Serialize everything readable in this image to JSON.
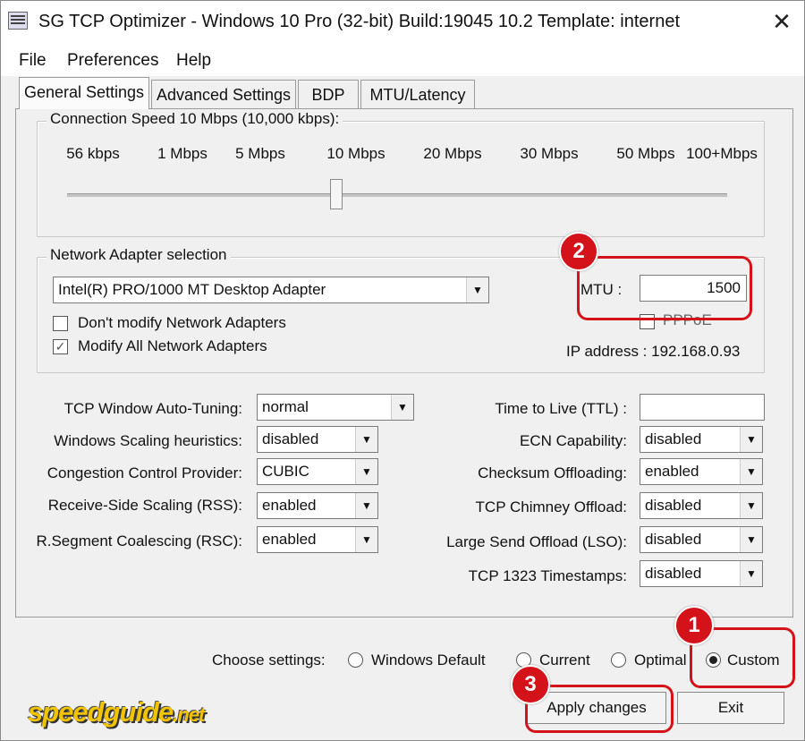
{
  "window": {
    "title": "SG TCP Optimizer - Windows 10 Pro (32-bit) Build:19045 10.2  Template: internet",
    "close_glyph": "✕"
  },
  "menu": [
    "File",
    "Preferences",
    "Help"
  ],
  "tabs": [
    "General Settings",
    "Advanced Settings",
    "BDP",
    "MTU/Latency"
  ],
  "connection_speed": {
    "legend": "Connection Speed  10 Mbps (10,000 kbps):",
    "ticks": [
      "56 kbps",
      "1 Mbps",
      "5 Mbps",
      "10 Mbps",
      "20 Mbps",
      "30 Mbps",
      "50 Mbps",
      "100+Mbps"
    ],
    "selected": "10 Mbps"
  },
  "adapter": {
    "legend": "Network Adapter selection",
    "selected": "Intel(R) PRO/1000 MT Desktop Adapter",
    "dont_modify_label": "Don't modify Network Adapters",
    "dont_modify_checked": false,
    "modify_all_label": "Modify All Network Adapters",
    "modify_all_checked": true,
    "mtu_label": "MTU :",
    "mtu_value": "1500",
    "pppoe_label": "PPPoE",
    "pppoe_checked": false,
    "ip_label": "IP address : 192.168.0.93"
  },
  "left_settings": [
    {
      "label": "TCP Window Auto-Tuning:",
      "value": "normal"
    },
    {
      "label": "Windows Scaling heuristics:",
      "value": "disabled"
    },
    {
      "label": "Congestion Control Provider:",
      "value": "CUBIC"
    },
    {
      "label": "Receive-Side Scaling (RSS):",
      "value": "enabled"
    },
    {
      "label": "R.Segment Coalescing (RSC):",
      "value": "enabled"
    }
  ],
  "right_settings": [
    {
      "label": "Time to Live (TTL) :",
      "value": ""
    },
    {
      "label": "ECN Capability:",
      "value": "disabled"
    },
    {
      "label": "Checksum Offloading:",
      "value": "enabled"
    },
    {
      "label": "TCP Chimney Offload:",
      "value": "disabled"
    },
    {
      "label": "Large Send Offload (LSO):",
      "value": "disabled"
    },
    {
      "label": "TCP 1323 Timestamps:",
      "value": "disabled"
    }
  ],
  "choose": {
    "label": "Choose settings:",
    "options": [
      "Windows Default",
      "Current",
      "Optimal",
      "Custom"
    ],
    "selected": "Custom"
  },
  "buttons": {
    "apply": "Apply changes",
    "exit": "Exit"
  },
  "callouts": [
    "1",
    "2",
    "3"
  ],
  "watermark": {
    "main": "speedguide",
    "tld": ".net"
  },
  "colors": {
    "callout": "#d4121a",
    "watermark": "#f2c400"
  }
}
